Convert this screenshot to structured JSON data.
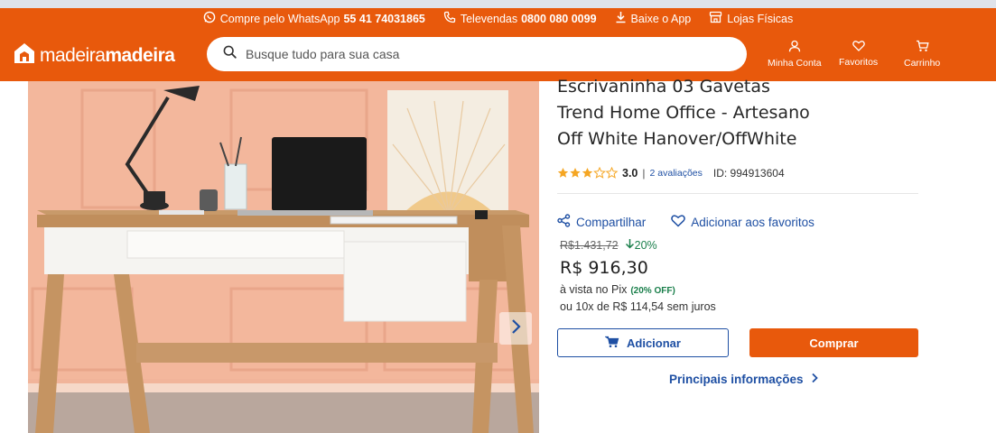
{
  "topbar": {
    "whatsapp_label": "Compre pelo WhatsApp",
    "whatsapp_number": "55 41 74031865",
    "televendas_label": "Televendas",
    "televendas_number": "0800 080 0099",
    "app_label": "Baixe o App",
    "stores_label": "Lojas Físicas"
  },
  "header": {
    "logo_part1": "madeira",
    "logo_part2": "madeira",
    "search_placeholder": "Busque tudo para sua casa",
    "account_label": "Minha Conta",
    "favorites_label": "Favoritos",
    "cart_label": "Carrinho"
  },
  "product": {
    "title_line1": "Escrivaninha 03 Gavetas",
    "title_line2": "Trend Home Office - Artesano",
    "title_line3": "Off White Hanover/OffWhite",
    "rating_value": "3.0",
    "rating_fraction": 0.6,
    "rating_separator": "|",
    "reviews_label": "2 avaliações",
    "product_id": "ID: 994913604",
    "share_label": "Compartilhar",
    "add_favorite_label": "Adicionar aos favoritos",
    "old_price": "R$1.431,72",
    "discount": "20%",
    "price": "R$ 916,30",
    "pix_label": "à vista no Pix",
    "pix_off": "(20% OFF)",
    "installments": "ou 10x de R$ 114,54 sem juros",
    "add_button": "Adicionar",
    "buy_button": "Comprar",
    "main_info_link": "Principais informações"
  },
  "colors": {
    "brand_orange": "#e8590c",
    "link_blue": "#1e4fa3",
    "discount_green": "#1a7f4b",
    "star_gold": "#f5a623"
  },
  "icons": [
    "whatsapp-icon",
    "phone-icon",
    "download-icon",
    "store-icon",
    "house-logo-icon",
    "search-icon",
    "user-icon",
    "heart-icon",
    "cart-icon",
    "share-icon",
    "arrow-down-icon",
    "chevron-right-icon"
  ]
}
